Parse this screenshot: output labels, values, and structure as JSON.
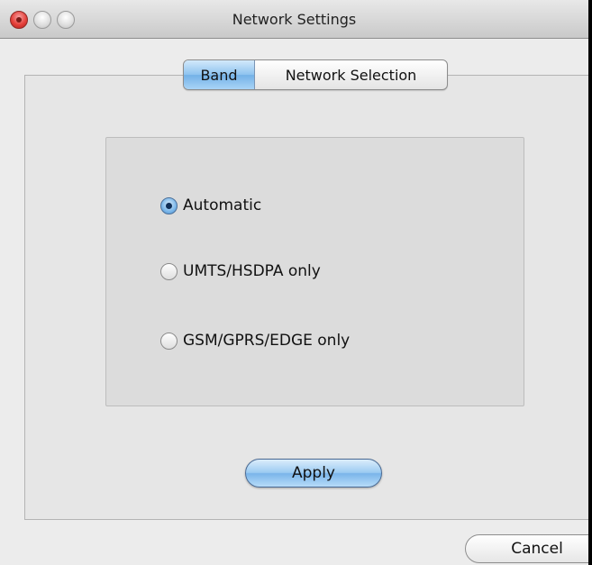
{
  "window": {
    "title": "Network Settings"
  },
  "tabs": [
    {
      "label": "Band",
      "selected": true
    },
    {
      "label": "Network Selection",
      "selected": false
    }
  ],
  "band_options": [
    {
      "label": "Automatic",
      "selected": true
    },
    {
      "label": "UMTS/HSDPA only",
      "selected": false
    },
    {
      "label": "GSM/GPRS/EDGE only",
      "selected": false
    }
  ],
  "buttons": {
    "apply_label": "Apply",
    "cancel_label": "Cancel"
  },
  "colors": {
    "accent": "#7ab5ea",
    "window_bg": "#ececec"
  }
}
